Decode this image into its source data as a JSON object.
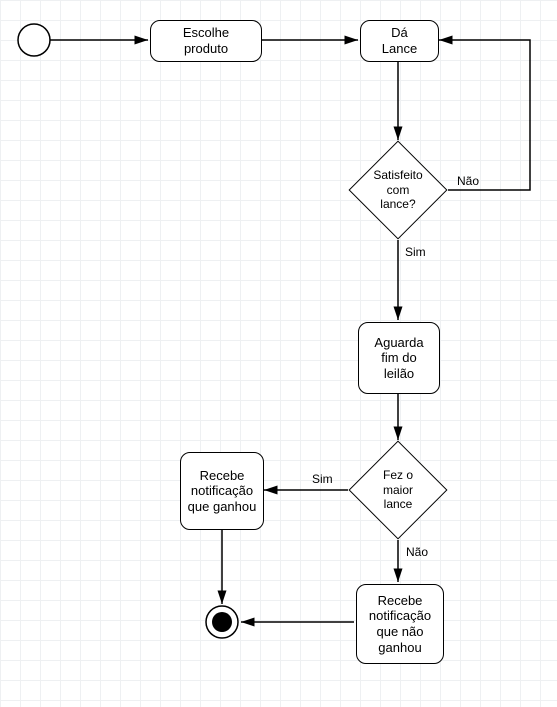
{
  "nodes": {
    "start": {
      "type": "start"
    },
    "choose_product": {
      "label": "Escolhe\nproduto"
    },
    "place_bid": {
      "label": "Dá\nLance"
    },
    "satisfied": {
      "label": "Satisfeito\ncom\nlance?"
    },
    "wait_end": {
      "label": "Aguarda\nfim do\nleilão"
    },
    "highest_bid": {
      "label": "Fez o\nmaior lance"
    },
    "notify_won": {
      "label": "Recebe\nnotificação\nque ganhou"
    },
    "notify_lost": {
      "label": "Recebe\nnotificação\nque não\nganhou"
    },
    "end": {
      "type": "end"
    }
  },
  "edge_labels": {
    "satisfied_no": "Não",
    "satisfied_yes": "Sim",
    "highest_yes": "Sim",
    "highest_no": "Não"
  }
}
